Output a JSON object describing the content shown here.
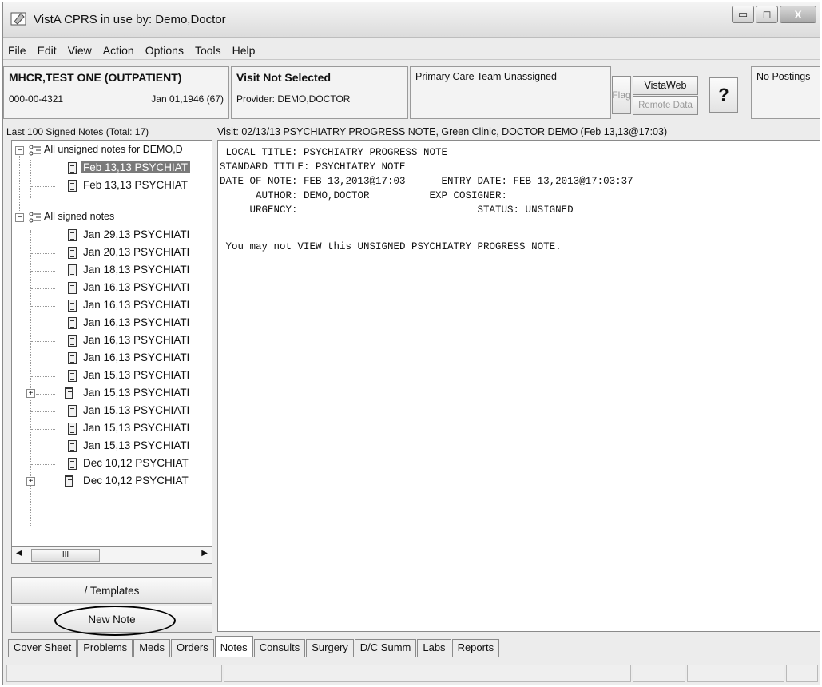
{
  "window": {
    "title": "VistA CPRS in use by: Demo,Doctor",
    "minimize_label": "▭",
    "maximize_label": "◻",
    "close_label": "X"
  },
  "menu": [
    "File",
    "Edit",
    "View",
    "Action",
    "Options",
    "Tools",
    "Help"
  ],
  "patient": {
    "name": "MHCR,TEST ONE (OUTPATIENT)",
    "ssn": "000-00-4321",
    "dob": "Jan 01,1946 (67)",
    "visit": "Visit Not Selected",
    "provider": "Provider: DEMO,DOCTOR",
    "care_team": "Primary Care Team Unassigned",
    "flag_label": "Flag",
    "vistaweb_label": "VistaWeb",
    "remote_data_label": "Remote Data",
    "help_label": "?",
    "postings": "No Postings"
  },
  "notes_list": {
    "header": "Last 100 Signed Notes (Total: 17)",
    "unsigned_group": "All unsigned notes for DEMO,D",
    "signed_group": "All signed notes",
    "unsigned": [
      "Feb 13,13 PSYCHIAT",
      "Feb 13,13 PSYCHIAT"
    ],
    "signed": [
      "Jan 29,13 PSYCHIATI",
      "Jan 20,13 PSYCHIATI",
      "Jan 18,13 PSYCHIATI",
      "Jan 16,13 PSYCHIATI",
      "Jan 16,13 PSYCHIATI",
      "Jan 16,13 PSYCHIATI",
      "Jan 16,13 PSYCHIATI",
      "Jan 16,13 PSYCHIATI",
      "Jan 15,13 PSYCHIATI",
      "Jan 15,13 PSYCHIATI",
      "Jan 15,13 PSYCHIATI",
      "Jan 15,13 PSYCHIATI",
      "Jan 15,13 PSYCHIATI",
      "Dec 10,12 PSYCHIAT",
      "Dec 10,12 PSYCHIAT"
    ],
    "scroll_thumb": "III",
    "templates_button": "/ Templates",
    "new_note_button": "New Note"
  },
  "note": {
    "header": "Visit: 02/13/13  PSYCHIATRY PROGRESS NOTE, Green Clinic, DOCTOR DEMO  (Feb 13,13@17:03)",
    "lines": [
      " LOCAL TITLE: PSYCHIATRY PROGRESS NOTE",
      "STANDARD TITLE: PSYCHIATRY NOTE",
      "DATE OF NOTE: FEB 13,2013@17:03      ENTRY DATE: FEB 13,2013@17:03:37",
      "      AUTHOR: DEMO,DOCTOR          EXP COSIGNER:",
      "     URGENCY:                              STATUS: UNSIGNED",
      "",
      " You may not VIEW this UNSIGNED PSYCHIATRY PROGRESS NOTE."
    ]
  },
  "tabs": [
    "Cover Sheet",
    "Problems",
    "Meds",
    "Orders",
    "Notes",
    "Consults",
    "Surgery",
    "D/C Summ",
    "Labs",
    "Reports"
  ],
  "active_tab": "Notes"
}
